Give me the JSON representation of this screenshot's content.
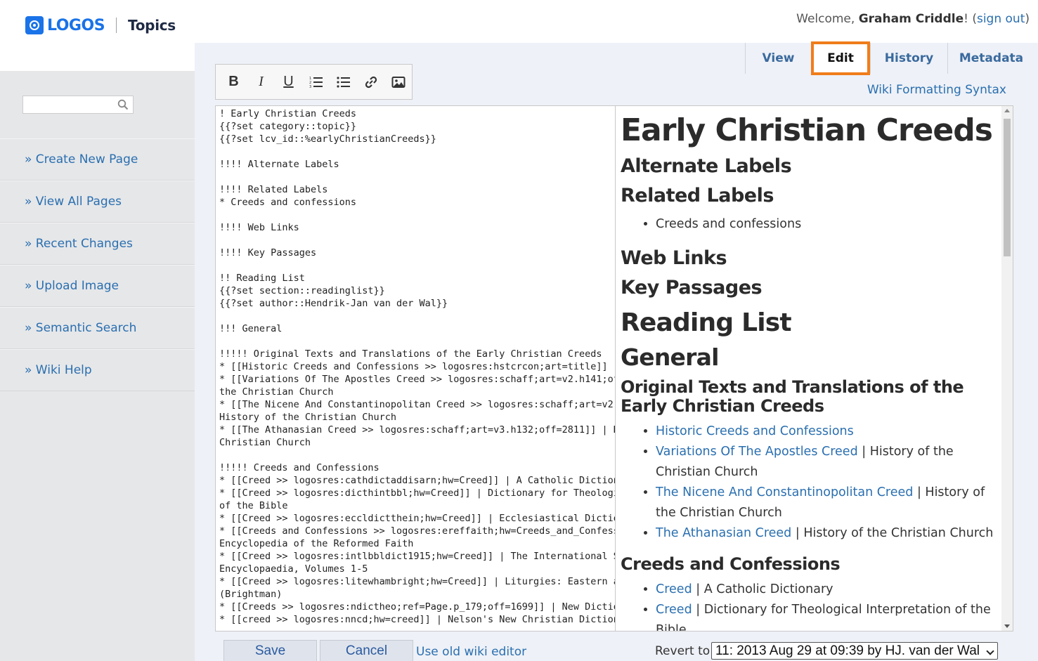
{
  "header": {
    "logo_text": "LOGOS",
    "section": "Topics",
    "welcome_prefix": "Welcome, ",
    "user_name": "Graham Criddle",
    "welcome_suffix": "! (",
    "sign_out": "sign out",
    "close_paren": ")"
  },
  "sidebar": {
    "search_placeholder": "",
    "items": [
      {
        "label": "» Create New Page"
      },
      {
        "label": "» View All Pages"
      },
      {
        "label": "» Recent Changes"
      },
      {
        "label": "» Upload Image"
      },
      {
        "label": "» Semantic Search"
      },
      {
        "label": "» Wiki Help"
      }
    ]
  },
  "tabs": {
    "view": "View",
    "edit": "Edit",
    "history": "History",
    "metadata": "Metadata",
    "active": "Edit",
    "highlight_color": "#f07d1a"
  },
  "wiki_syntax_link": "Wiki Formatting Syntax",
  "toolbar": {
    "bold": "B",
    "italic": "I",
    "underline": "U",
    "icons": [
      "bold-icon",
      "italic-icon",
      "underline-icon",
      "numbered-list-icon",
      "bullet-list-icon",
      "link-icon",
      "image-icon"
    ]
  },
  "source_text": "! Early Christian Creeds\n{{?set category::topic}}\n{{?set lcv_id::%earlyChristianCreeds}}\n\n!!!! Alternate Labels\n\n!!!! Related Labels\n* Creeds and confessions\n\n!!!! Web Links\n\n!!!! Key Passages\n\n!! Reading List\n{{?set section::readinglist}}\n{{?set author::Hendrik-Jan van der Wal}}\n\n!!! General\n\n!!!!! Original Texts and Translations of the Early Christian Creeds\n* [[Historic Creeds and Confessions >> logosres:hstcrcon;art=title]] |\n* [[Variations Of The Apostles Creed >> logosres:schaff;art=v2.h141;off=\nthe Christian Church\n* [[The Nicene And Constantinopolitan Creed >> logosres:schaff;art=v2.h\nHistory of the Christian Church\n* [[The Athanasian Creed >> logosres:schaff;art=v3.h132;off=2811]] | Hi\nChristian Church\n\n!!!!! Creeds and Confessions\n* [[Creed >> logosres:cathdictaddisarn;hw=Creed]] | A Catholic Dictiona\n* [[Creed >> logosres:dicthintbbl;hw=Creed]] | Dictionary for Theologica\nof the Bible\n* [[Creed >> logosres:eccldictthein;hw=Creed]] | Ecclesiastical Diction\n* [[Creeds and Confessions >> logosres:ereffaith;hw=Creeds_and_Confessi\nEncyclopedia of the Reformed Faith\n* [[Creed >> logosres:intlbbldict1915;hw=Creed]] | The International St\nEncyclopaedia, Volumes 1-5\n* [[Creed >> logosres:litewhambright;hw=Creed]] | Liturgies: Eastern an\n(Brightman)\n* [[Creeds >> logosres:ndictheo;ref=Page.p_179;off=1699]] | New Diction\n* [[creed >> logosres:nncd;hw=creed]] | Nelson's New Christian Dictiona",
  "preview": {
    "title": "Early Christian Creeds",
    "alternate_labels": "Alternate Labels",
    "related_labels": "Related Labels",
    "related_items": [
      "Creeds and confessions"
    ],
    "web_links": "Web Links",
    "key_passages": "Key Passages",
    "reading_list": "Reading List",
    "general": "General",
    "original_texts": "Original Texts and Translations of the Early Christian Creeds",
    "original_items": [
      {
        "link": "Historic Creeds and Confessions",
        "rest": ""
      },
      {
        "link": "Variations Of The Apostles Creed",
        "rest": " | History of the Christian Church"
      },
      {
        "link": "The Nicene And Constantinopolitan Creed",
        "rest": " | History of the Christian Church"
      },
      {
        "link": "The Athanasian Creed",
        "rest": " | History of the Christian Church"
      }
    ],
    "creeds_confessions": "Creeds and Confessions",
    "creeds_items": [
      {
        "link": "Creed",
        "rest": " | A Catholic Dictionary"
      },
      {
        "link": "Creed",
        "rest": " | Dictionary for Theological Interpretation of the Bible"
      }
    ]
  },
  "footer": {
    "save": "Save",
    "cancel": "Cancel",
    "old_editor": "Use old wiki editor",
    "revert_label": "Revert to:",
    "revert_value": "11: 2013 Aug 29 at 09:39 by HJ. van der Wal"
  }
}
